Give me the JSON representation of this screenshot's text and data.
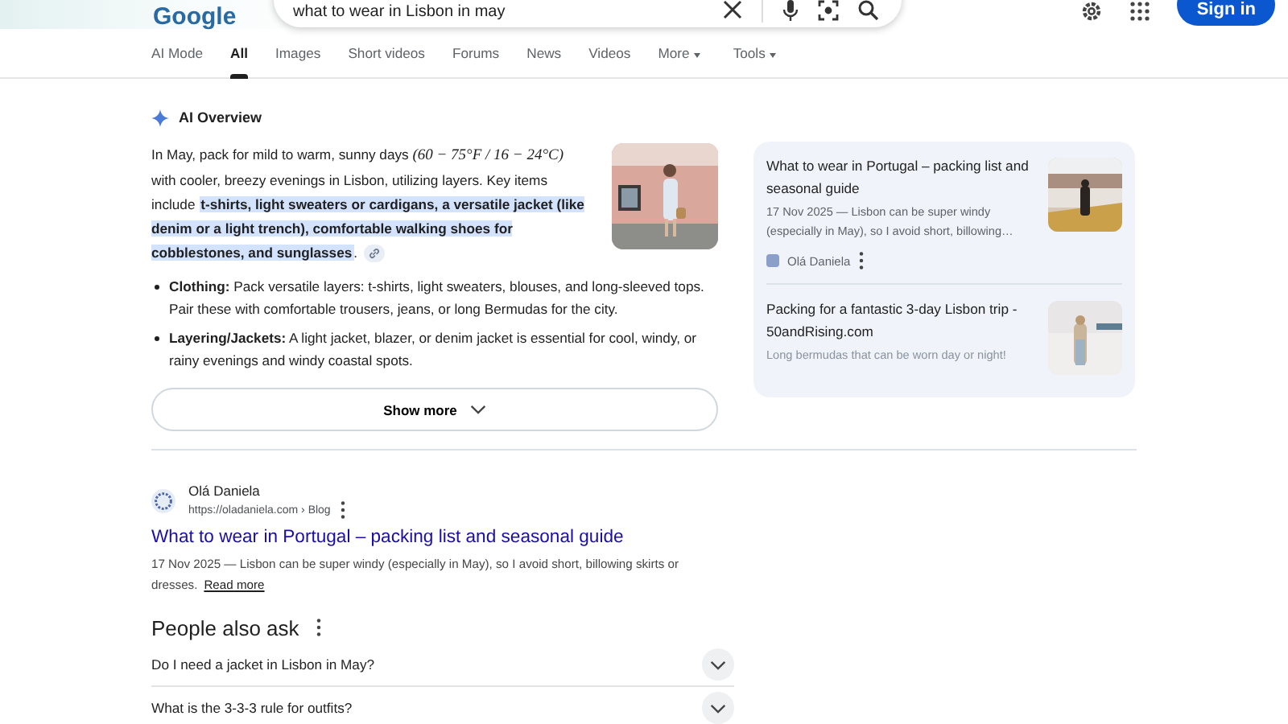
{
  "header": {
    "logo": "Google",
    "query": "what to wear in Lisbon in may",
    "sign_in": "Sign in"
  },
  "tabs": [
    {
      "label": "AI Mode",
      "selected": false,
      "dropdown": false
    },
    {
      "label": "All",
      "selected": true,
      "dropdown": false
    },
    {
      "label": "Images",
      "selected": false,
      "dropdown": false
    },
    {
      "label": "Short videos",
      "selected": false,
      "dropdown": false
    },
    {
      "label": "Forums",
      "selected": false,
      "dropdown": false
    },
    {
      "label": "News",
      "selected": false,
      "dropdown": false
    },
    {
      "label": "Videos",
      "selected": false,
      "dropdown": false
    },
    {
      "label": "More",
      "selected": false,
      "dropdown": true
    },
    {
      "label": "Tools",
      "selected": false,
      "dropdown": true
    }
  ],
  "ai_overview": {
    "title": "AI Overview",
    "summary": [
      {
        "kind": "plain",
        "text": "In May, pack for mild to warm, sunny days "
      },
      {
        "kind": "math",
        "text": "(60 − 75°F / 16 − 24°C)"
      },
      {
        "kind": "plain",
        "text": " with cooler, breezy evenings in Lisbon, utilizing layers. Key items include "
      },
      {
        "kind": "highlight",
        "text": "t-shirts, light sweaters or cardigans, a versatile jacket (like denim or a light trench), comfortable walking shoes for cobblestones, and sunglasses"
      },
      {
        "kind": "plain",
        "text": "."
      }
    ],
    "bullets": [
      "**Clothing:** Pack versatile layers: t-shirts, light sweaters, blouses, and long-sleeved tops. Pair these with comfortable trousers, jeans, or long Bermudas for the city.",
      "**Layering/Jackets:** A light jacket, blazer, or denim jacket is essential for cool, windy, or rainy evenings and windy coastal spots."
    ],
    "show_more": "Show more",
    "sources": [
      {
        "title": "What to wear in Portugal – packing list and seasonal guide",
        "snippet": "17 Nov 2025 — Lisbon can be super windy (especially in May), so I avoid short, billowing…",
        "source": "Olá Daniela"
      },
      {
        "title": "Packing for a fantastic 3-day Lisbon trip - 50andRising.com",
        "snippet": "Long bermudas that can be worn day or night!"
      }
    ]
  },
  "result": {
    "site": "Olá Daniela",
    "url": "https://oladaniela.com › Blog",
    "title": "What to wear in Portugal – packing list and seasonal guide",
    "snippet": "17 Nov 2025 — Lisbon can be super windy (especially in May), so I avoid short, billowing skirts or dresses.",
    "read_more": "Read more"
  },
  "people_also_ask": {
    "title": "People also ask",
    "questions": [
      "Do I need a jacket in Lisbon in May?",
      "What is the 3-3-3 rule for outfits?"
    ]
  }
}
